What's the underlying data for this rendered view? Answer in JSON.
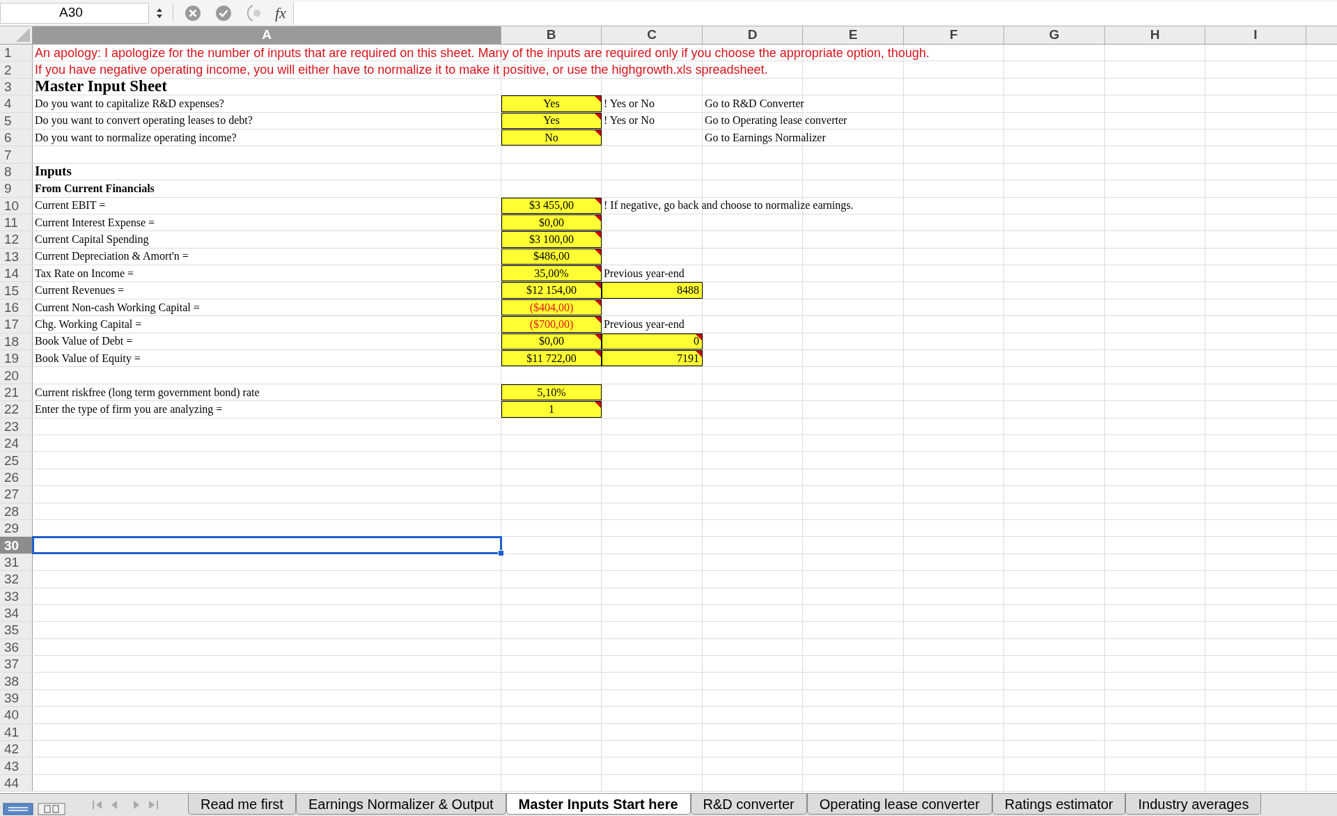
{
  "formula_bar": {
    "name_box": "A30",
    "fx": "fx"
  },
  "columns": [
    {
      "label": "A",
      "selected": true
    },
    {
      "label": "B",
      "selected": false
    },
    {
      "label": "C",
      "selected": false
    },
    {
      "label": "D",
      "selected": false
    },
    {
      "label": "E",
      "selected": false
    },
    {
      "label": "F",
      "selected": false
    },
    {
      "label": "G",
      "selected": false
    },
    {
      "label": "H",
      "selected": false
    },
    {
      "label": "I",
      "selected": false
    }
  ],
  "rows": [
    {
      "number": "1",
      "selected": false,
      "cells": {
        "A": {
          "kind": "note",
          "text": "An apology: I apologize for the number of inputs that are required on this sheet. Many of the inputs are required only if you choose the appropriate option, though."
        }
      }
    },
    {
      "number": "2",
      "selected": false,
      "cells": {
        "A": {
          "kind": "note",
          "text": "If you have negative operating income, you will either have to normalize it to make it positive, or use the highgrowth.xls spreadsheet."
        }
      }
    },
    {
      "number": "3",
      "selected": false,
      "cells": {
        "A": {
          "kind": "title",
          "text": "Master Input Sheet"
        }
      }
    },
    {
      "number": "4",
      "selected": false,
      "cells": {
        "A": {
          "kind": "label",
          "text": "Do you want to capitalize R&D expenses?"
        },
        "B": {
          "kind": "input",
          "text": "Yes",
          "comment": true,
          "negative": false
        },
        "C": {
          "kind": "label",
          "text": "! Yes or No"
        },
        "D": {
          "kind": "label",
          "text": "Go to R&D Converter"
        }
      }
    },
    {
      "number": "5",
      "selected": false,
      "cells": {
        "A": {
          "kind": "label",
          "text": "Do you want to convert operating leases to debt?"
        },
        "B": {
          "kind": "input",
          "text": "Yes",
          "comment": true,
          "negative": false
        },
        "C": {
          "kind": "label",
          "text": "! Yes or No"
        },
        "D": {
          "kind": "label",
          "text": "Go to Operating lease converter"
        }
      }
    },
    {
      "number": "6",
      "selected": false,
      "cells": {
        "A": {
          "kind": "label",
          "text": "Do you want to normalize operating income?"
        },
        "B": {
          "kind": "input",
          "text": "No",
          "comment": true,
          "negative": false
        },
        "D": {
          "kind": "label",
          "text": "Go to Earnings Normalizer"
        }
      }
    },
    {
      "number": "7",
      "selected": false,
      "cells": {}
    },
    {
      "number": "8",
      "selected": false,
      "cells": {
        "A": {
          "kind": "heading",
          "text": "Inputs"
        }
      }
    },
    {
      "number": "9",
      "selected": false,
      "cells": {
        "A": {
          "kind": "subheading",
          "text": "From Current Financials"
        }
      }
    },
    {
      "number": "10",
      "selected": false,
      "cells": {
        "A": {
          "kind": "label",
          "text": "Current EBIT ="
        },
        "B": {
          "kind": "input",
          "text": "$3 455,00",
          "comment": true,
          "negative": false
        },
        "C": {
          "kind": "label",
          "text": "! If negative, go back and choose to normalize earnings."
        }
      }
    },
    {
      "number": "11",
      "selected": false,
      "cells": {
        "A": {
          "kind": "label",
          "text": "Current Interest Expense ="
        },
        "B": {
          "kind": "input",
          "text": "$0,00",
          "comment": true,
          "negative": false
        }
      }
    },
    {
      "number": "12",
      "selected": false,
      "cells": {
        "A": {
          "kind": "label",
          "text": "Current Capital Spending"
        },
        "B": {
          "kind": "input",
          "text": "$3 100,00",
          "comment": true,
          "negative": false
        }
      }
    },
    {
      "number": "13",
      "selected": false,
      "cells": {
        "A": {
          "kind": "label",
          "text": "Current Depreciation & Amort'n ="
        },
        "B": {
          "kind": "input",
          "text": "$486,00",
          "comment": true,
          "negative": false
        }
      }
    },
    {
      "number": "14",
      "selected": false,
      "cells": {
        "A": {
          "kind": "label",
          "text": "Tax Rate on Income ="
        },
        "B": {
          "kind": "input",
          "text": "35,00%",
          "comment": true,
          "negative": false
        },
        "C": {
          "kind": "label",
          "text": "Previous year-end"
        }
      }
    },
    {
      "number": "15",
      "selected": false,
      "cells": {
        "A": {
          "kind": "label",
          "text": "Current Revenues ="
        },
        "B": {
          "kind": "input",
          "text": "$12 154,00",
          "comment": true,
          "negative": false
        },
        "C": {
          "kind": "prior",
          "text": "8488",
          "comment": false
        }
      }
    },
    {
      "number": "16",
      "selected": false,
      "cells": {
        "A": {
          "kind": "label",
          "text": "Current Non-cash Working Capital ="
        },
        "B": {
          "kind": "input",
          "text": "($404,00)",
          "comment": true,
          "negative": true
        }
      }
    },
    {
      "number": "17",
      "selected": false,
      "cells": {
        "A": {
          "kind": "label",
          "text": "Chg. Working Capital ="
        },
        "B": {
          "kind": "input",
          "text": "($700,00)",
          "comment": true,
          "negative": true
        },
        "C": {
          "kind": "label",
          "text": "Previous year-end"
        }
      }
    },
    {
      "number": "18",
      "selected": false,
      "cells": {
        "A": {
          "kind": "label",
          "text": "Book Value of Debt ="
        },
        "B": {
          "kind": "input",
          "text": "$0,00",
          "comment": true,
          "negative": false
        },
        "C": {
          "kind": "prior",
          "text": "0",
          "comment": true
        }
      }
    },
    {
      "number": "19",
      "selected": false,
      "cells": {
        "A": {
          "kind": "label",
          "text": "Book Value of Equity ="
        },
        "B": {
          "kind": "input",
          "text": "$11 722,00",
          "comment": true,
          "negative": false
        },
        "C": {
          "kind": "prior",
          "text": "7191",
          "comment": true
        }
      }
    },
    {
      "number": "20",
      "selected": false,
      "cells": {}
    },
    {
      "number": "21",
      "selected": false,
      "cells": {
        "A": {
          "kind": "label",
          "text": "Current riskfree (long term government bond) rate"
        },
        "B": {
          "kind": "input",
          "text": "5,10%",
          "comment": false,
          "negative": false
        }
      }
    },
    {
      "number": "22",
      "selected": false,
      "cells": {
        "A": {
          "kind": "label",
          "text": "Enter the type of firm you are analyzing ="
        },
        "B": {
          "kind": "input",
          "text": "1",
          "comment": true,
          "negative": false
        }
      }
    },
    {
      "number": "23",
      "selected": false,
      "cells": {}
    },
    {
      "number": "24",
      "selected": false,
      "cells": {}
    },
    {
      "number": "25",
      "selected": false,
      "cells": {}
    },
    {
      "number": "26",
      "selected": false,
      "cells": {}
    },
    {
      "number": "27",
      "selected": false,
      "cells": {}
    },
    {
      "number": "28",
      "selected": false,
      "cells": {}
    },
    {
      "number": "29",
      "selected": false,
      "cells": {}
    },
    {
      "number": "30",
      "selected": true,
      "cells": {}
    },
    {
      "number": "31",
      "selected": false,
      "cells": {}
    },
    {
      "number": "32",
      "selected": false,
      "cells": {}
    },
    {
      "number": "33",
      "selected": false,
      "cells": {}
    },
    {
      "number": "34",
      "selected": false,
      "cells": {}
    },
    {
      "number": "35",
      "selected": false,
      "cells": {}
    },
    {
      "number": "36",
      "selected": false,
      "cells": {}
    },
    {
      "number": "37",
      "selected": false,
      "cells": {}
    },
    {
      "number": "38",
      "selected": false,
      "cells": {}
    },
    {
      "number": "39",
      "selected": false,
      "cells": {}
    },
    {
      "number": "40",
      "selected": false,
      "cells": {}
    },
    {
      "number": "41",
      "selected": false,
      "cells": {}
    },
    {
      "number": "42",
      "selected": false,
      "cells": {}
    },
    {
      "number": "43",
      "selected": false,
      "cells": {}
    },
    {
      "number": "44",
      "selected": false,
      "cells": {}
    }
  ],
  "sheet_tabs": [
    {
      "label": "Read me first",
      "selected": false
    },
    {
      "label": "Earnings Normalizer & Output",
      "selected": false
    },
    {
      "label": "Master Inputs Start here",
      "selected": true
    },
    {
      "label": "R&D converter",
      "selected": false
    },
    {
      "label": "Operating lease converter",
      "selected": false
    },
    {
      "label": "Ratings estimator",
      "selected": false
    },
    {
      "label": "Industry averages",
      "selected": false
    }
  ]
}
